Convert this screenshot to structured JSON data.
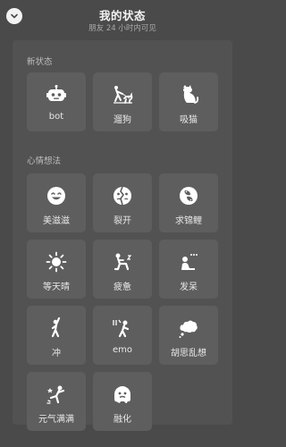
{
  "header": {
    "title": "我的状态",
    "subtitle": "朋友 24 小时内可见"
  },
  "sections": {
    "new_status": {
      "title": "新状态",
      "items": [
        {
          "label": "bot",
          "icon": "robot-icon"
        },
        {
          "label": "遛狗",
          "icon": "walking-dog-icon"
        },
        {
          "label": "吸猫",
          "icon": "cat-icon"
        }
      ]
    },
    "mood": {
      "title": "心情想法",
      "items": [
        {
          "label": "美滋滋",
          "icon": "smile-face-icon"
        },
        {
          "label": "裂开",
          "icon": "cracked-face-icon"
        },
        {
          "label": "求锦鲤",
          "icon": "koi-icon"
        },
        {
          "label": "等天晴",
          "icon": "sun-icon"
        },
        {
          "label": "疲惫",
          "icon": "tired-person-icon"
        },
        {
          "label": "发呆",
          "icon": "daydream-person-icon"
        },
        {
          "label": "冲",
          "icon": "rush-person-icon"
        },
        {
          "label": "emo",
          "icon": "emo-person-icon"
        },
        {
          "label": "胡思乱想",
          "icon": "thought-cloud-icon"
        },
        {
          "label": "元气满满",
          "icon": "energetic-person-icon"
        },
        {
          "label": "融化",
          "icon": "melting-face-icon"
        }
      ]
    }
  }
}
